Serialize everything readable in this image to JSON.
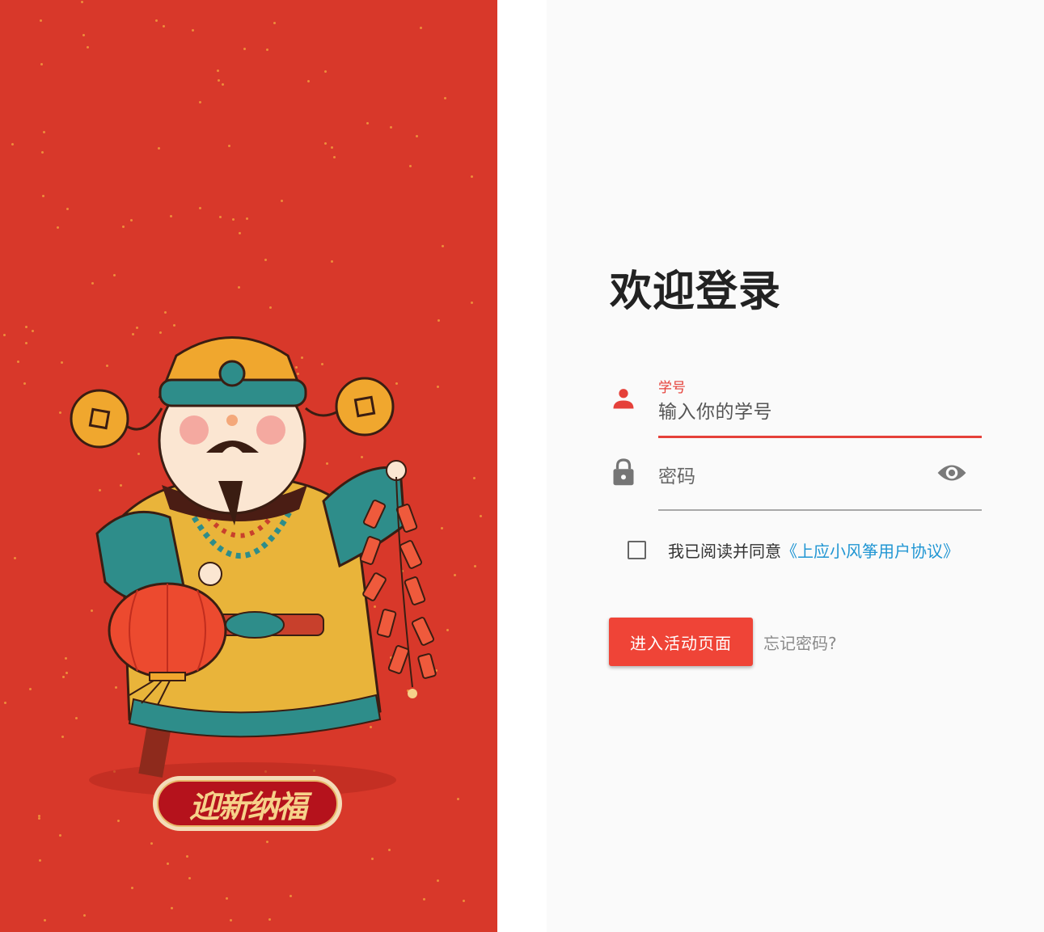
{
  "art": {
    "badge_text": "迎新纳福"
  },
  "login": {
    "title": "欢迎登录",
    "student_id": {
      "label": "学号",
      "value": "输入你的学号",
      "icon": "person-icon"
    },
    "password": {
      "placeholder": "密码",
      "icon": "lock-icon",
      "toggle_icon": "eye-icon"
    },
    "agreement": {
      "checked": false,
      "text": "我已阅读并同意",
      "link": "《上应小风筝用户协议》"
    },
    "enter_button_label": "进入活动页面",
    "forgot_label": "忘记密码?"
  },
  "colors": {
    "accent": "#ef4437",
    "link": "#2196d3",
    "art_background": "#d8382a"
  }
}
